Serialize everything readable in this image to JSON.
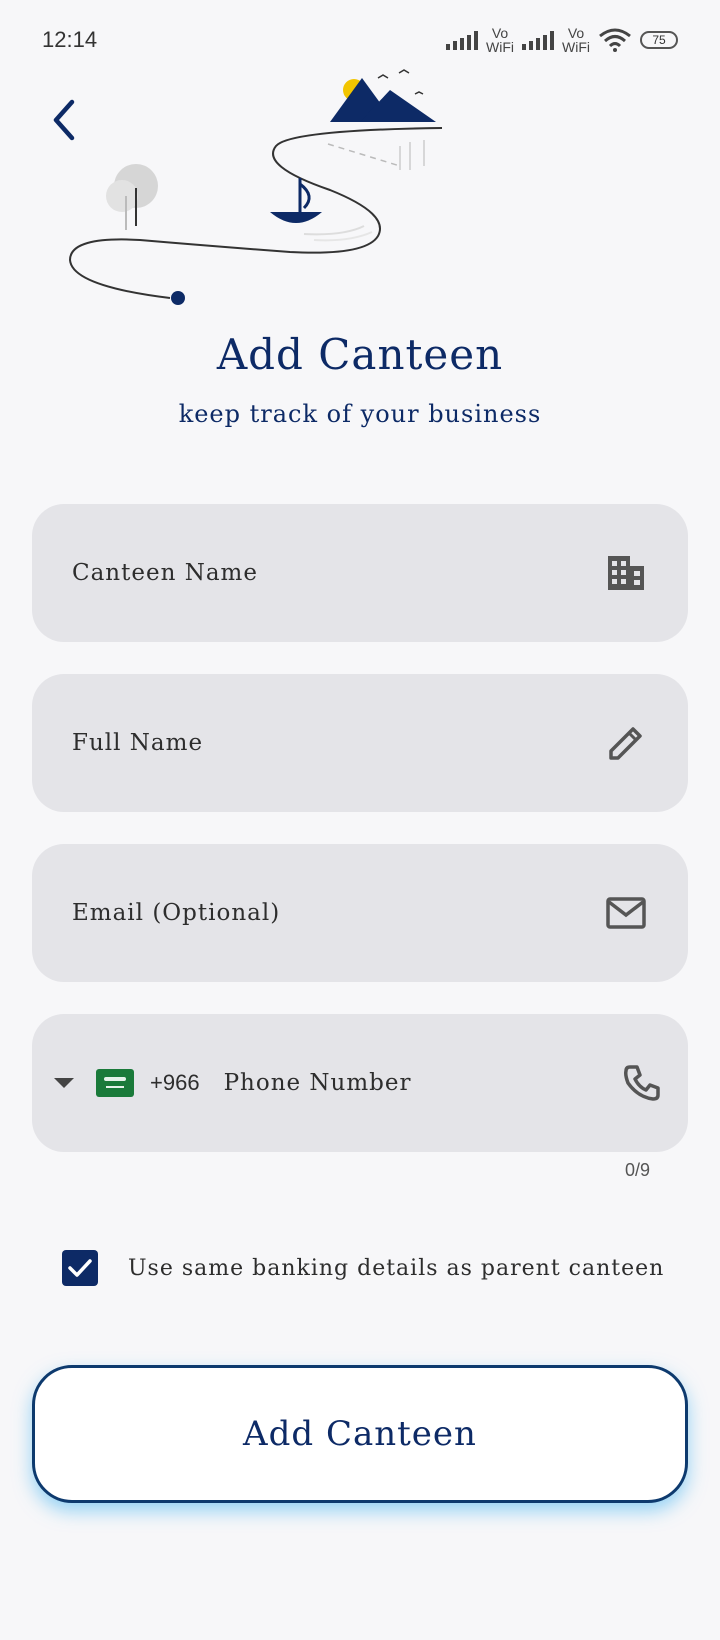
{
  "status_bar": {
    "time": "12:14",
    "vowifi_1_top": "Vo",
    "vowifi_1_bottom": "WiFi",
    "vowifi_2_top": "Vo",
    "vowifi_2_bottom": "WiFi",
    "battery": "75"
  },
  "header": {
    "title": "Add Canteen",
    "subtitle": "keep track of your business"
  },
  "form": {
    "canteen_name_placeholder": "Canteen Name",
    "full_name_placeholder": "Full Name",
    "email_placeholder": "Email (Optional)",
    "phone": {
      "dial_code": "+966",
      "placeholder": "Phone Number",
      "counter": "0/9"
    },
    "same_banking_label": "Use same banking details as parent canteen",
    "same_banking_checked": true,
    "submit_label": "Add Canteen"
  },
  "colors": {
    "primary": "#0d2a66",
    "field_bg": "#e4e4e8",
    "glow": "#46b4f0"
  },
  "icons": {
    "back": "chevron-left-icon",
    "canteen": "building-icon",
    "name": "pencil-icon",
    "email": "envelope-icon",
    "phone": "phone-icon",
    "flag": "saudi-flag-icon",
    "check": "check-icon"
  }
}
